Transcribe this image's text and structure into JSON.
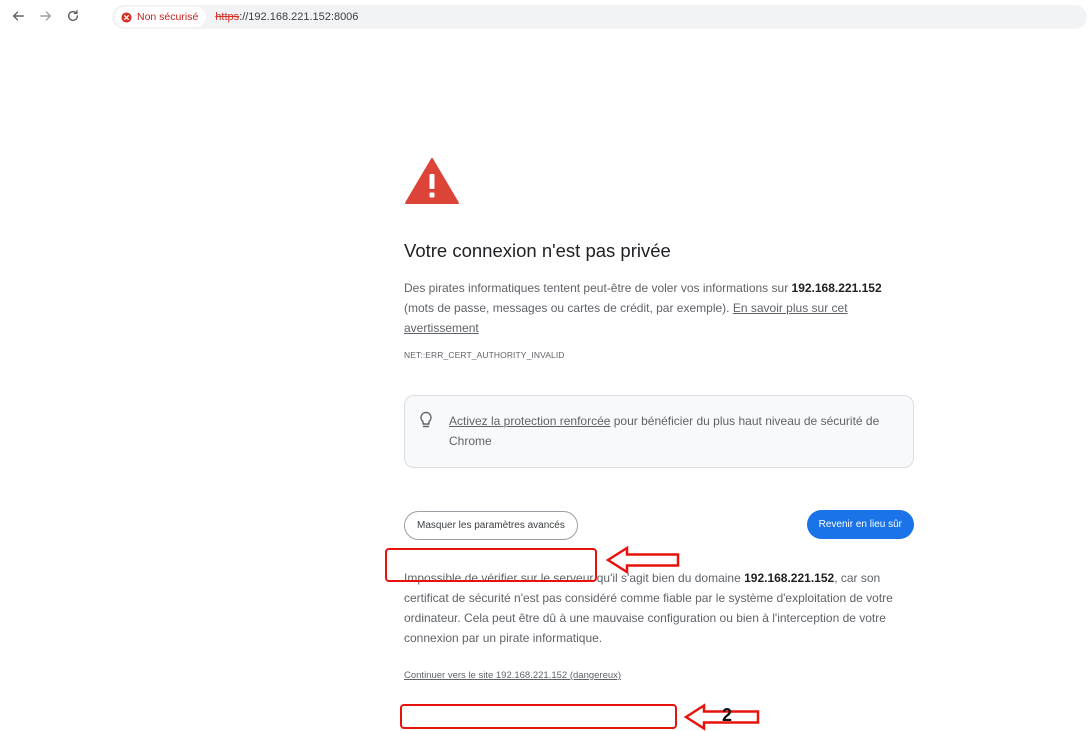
{
  "browser": {
    "security_label": "Non sécurisé",
    "url_scheme": "https",
    "url_rest": "://192.168.221.152:8006",
    "icons": {
      "back": "arrow-left-icon",
      "forward": "arrow-right-icon",
      "reload": "reload-icon",
      "security": "not-secure-icon"
    }
  },
  "page": {
    "icon": "warning-triangle-icon",
    "title": "Votre connexion n'est pas privée",
    "intro_text_1": "Des pirates informatiques tentent peut-être de voler vos informations sur ",
    "intro_host": "192.168.221.152",
    "intro_text_2": " (mots de passe, messages ou cartes de crédit, par exemple). ",
    "learn_more_link": "En savoir plus sur cet avertissement",
    "error_code": "NET::ERR_CERT_AUTHORITY_INVALID",
    "enhanced": {
      "icon": "lightbulb-icon",
      "link": "Activez la protection renforcée",
      "text": " pour bénéficier du plus haut niveau de sécurité de Chrome"
    },
    "advanced_button": "Masquer les paramètres avancés",
    "back_button": "Revenir en lieu sûr",
    "details_text_1": "Impossible de vérifier sur le serveur qu'il s'agit bien du domaine ",
    "details_host": "192.168.221.152",
    "details_text_2": ", car son certificat de sécurité n'est pas considéré comme fiable par le système d'exploitation de votre ordinateur. Cela peut être dû à une mauvaise configuration ou bien à l'interception de votre connexion par un pirate informatique.",
    "proceed_link": "Continuer vers le site 192.168.221.152 (dangereux)"
  },
  "annotations": {
    "color": "#e8120c",
    "step_number": "2"
  },
  "colors": {
    "warning_red": "#db4437",
    "primary_blue": "#1a73e8",
    "text_secondary": "#5f6368"
  }
}
